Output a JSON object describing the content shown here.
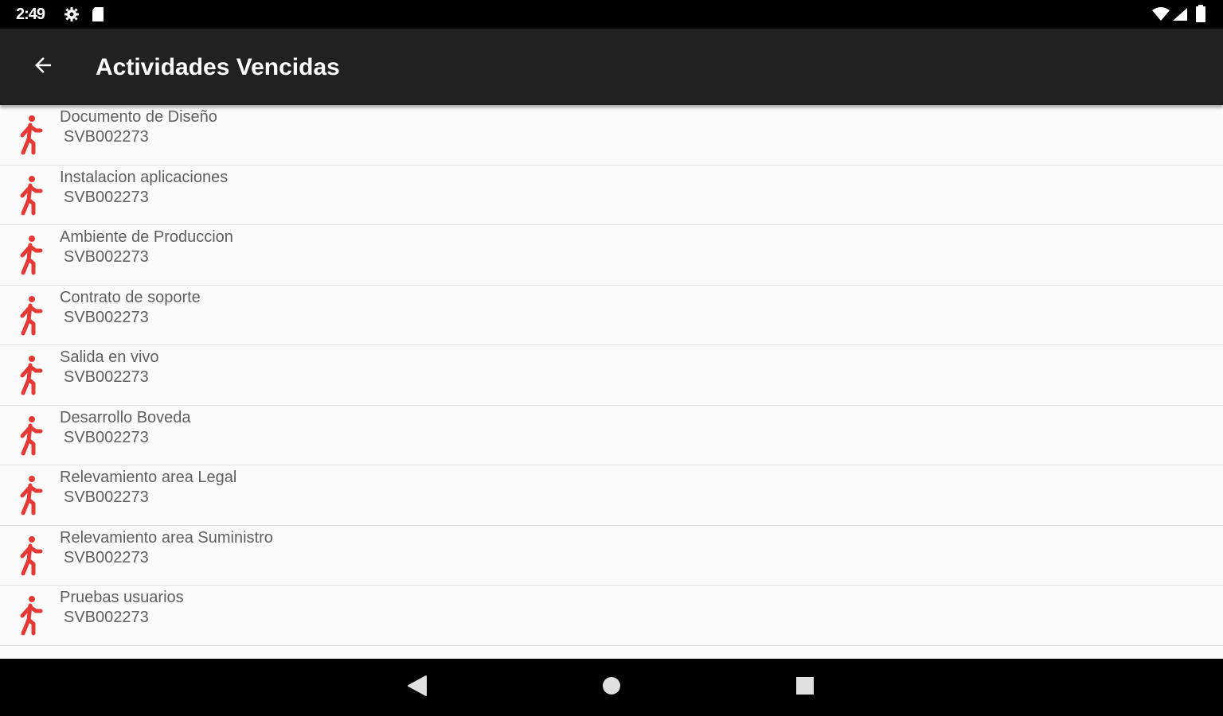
{
  "status_bar": {
    "time": "2:49",
    "left_icons": [
      "gear-icon",
      "sd-card-icon"
    ],
    "right_icons": [
      "wifi-icon",
      "signal-icon",
      "battery-icon"
    ]
  },
  "app_bar": {
    "title": "Actividades Vencidas",
    "back_icon": "arrow-back-icon"
  },
  "list": {
    "item_icon": "walking-person-icon",
    "icon_color": "#e53935",
    "items": [
      {
        "title": "Documento de Diseño",
        "code": "SVB002273"
      },
      {
        "title": "Instalacion aplicaciones",
        "code": "SVB002273"
      },
      {
        "title": "Ambiente de Produccion",
        "code": "SVB002273"
      },
      {
        "title": "Contrato de soporte",
        "code": "SVB002273"
      },
      {
        "title": "Salida en vivo",
        "code": "SVB002273"
      },
      {
        "title": "Desarrollo Boveda",
        "code": "SVB002273"
      },
      {
        "title": "Relevamiento area Legal",
        "code": "SVB002273"
      },
      {
        "title": "Relevamiento area Suministro",
        "code": "SVB002273"
      },
      {
        "title": "Pruebas usuarios",
        "code": "SVB002273"
      }
    ]
  },
  "nav_bar": {
    "icons": [
      "nav-back-icon",
      "nav-home-icon",
      "nav-recents-icon"
    ]
  }
}
